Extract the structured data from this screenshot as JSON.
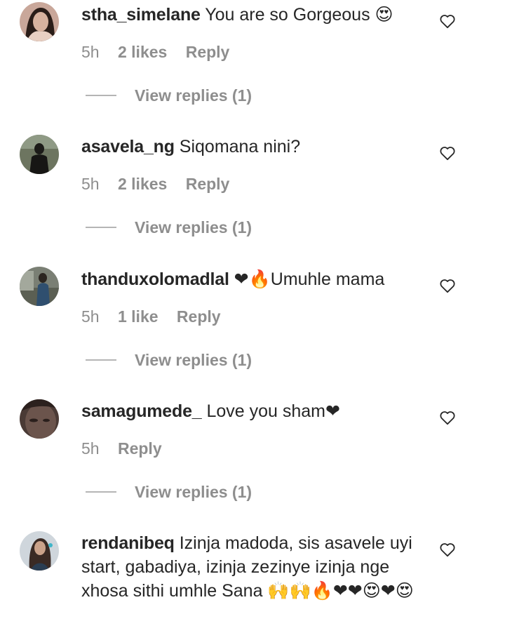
{
  "comments": [
    {
      "username": "stha_simelane",
      "text": "You are so Gorgeous 😍",
      "time": "5h",
      "likes": "2 likes",
      "reply": "Reply",
      "view_replies": "View replies (1)"
    },
    {
      "username": "asavela_ng",
      "text": "Siqomana nini?",
      "time": "5h",
      "likes": "2 likes",
      "reply": "Reply",
      "view_replies": "View replies (1)"
    },
    {
      "username": "thanduxolomadlal",
      "text": "❤🔥Umuhle mama",
      "time": "5h",
      "likes": "1 like",
      "reply": "Reply",
      "view_replies": "View replies (1)"
    },
    {
      "username": "samagumede_",
      "text": "Love you sham❤",
      "time": "5h",
      "reply": "Reply",
      "view_replies": "View replies (1)"
    },
    {
      "username": "rendanibeq",
      "text": "Izinja madoda, sis asavele uyi start, gabadiya, izinja zezinye izinja nge xhosa sithi umhle Sana 🙌🙌🔥❤❤😍❤😍"
    }
  ],
  "icons": {
    "like": "heart-outline-icon"
  },
  "colors": {
    "text": "#262626",
    "secondary": "#8e8e8e"
  }
}
